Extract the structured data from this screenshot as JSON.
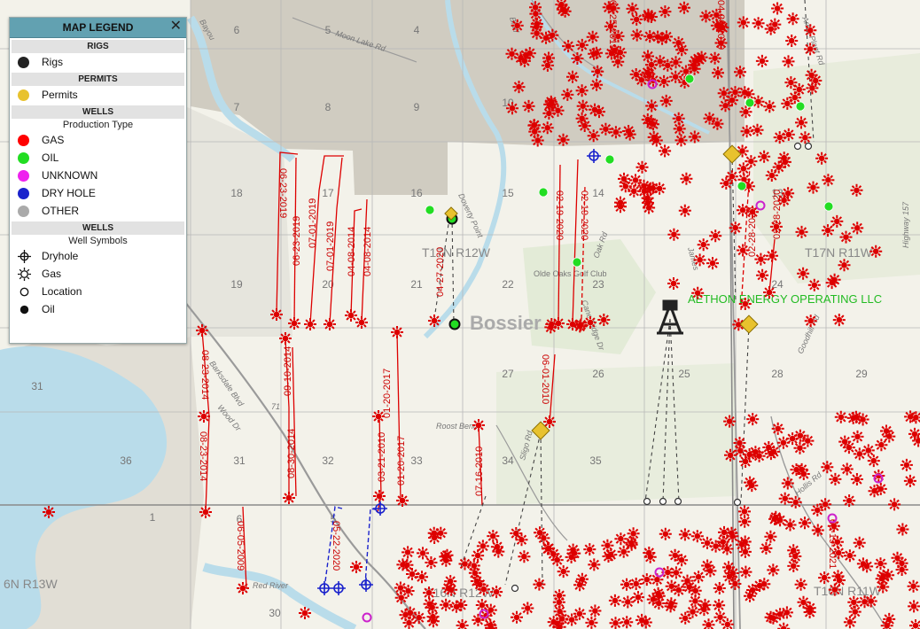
{
  "legend": {
    "title": "MAP LEGEND",
    "close_icon": "close-icon",
    "sections": {
      "rigs": {
        "header": "RIGS",
        "items": [
          {
            "label": "Rigs",
            "color": "#222222"
          }
        ]
      },
      "permits": {
        "header": "PERMITS",
        "items": [
          {
            "label": "Permits",
            "color": "#e8c22e"
          }
        ]
      },
      "wells": {
        "header": "WELLS",
        "subheader": "Production Type",
        "items": [
          {
            "label": "GAS",
            "color": "#ff0000"
          },
          {
            "label": "OIL",
            "color": "#22dd22"
          },
          {
            "label": "UNKNOWN",
            "color": "#ee22ee"
          },
          {
            "label": "DRY HOLE",
            "color": "#1a22cc"
          },
          {
            "label": "OTHER",
            "color": "#aaaaaa"
          }
        ]
      },
      "symbols": {
        "header": "WELLS",
        "subheader": "Well Symbols",
        "items": [
          {
            "label": "Dryhole",
            "icon": "dryhole-symbol-icon"
          },
          {
            "label": "Gas",
            "icon": "gas-symbol-icon"
          },
          {
            "label": "Location",
            "icon": "location-symbol-icon"
          },
          {
            "label": "Oil",
            "icon": "oil-symbol-icon"
          }
        ]
      }
    }
  },
  "map": {
    "colors": {
      "gas": "#dd0000",
      "oil": "#22dd22",
      "unknown": "#cc22cc",
      "dryhole": "#1a22cc",
      "permit": "#e8c22e",
      "water": "#b9dcea",
      "urban": "#c9c6ba"
    },
    "township_labels": [
      "T17N R12W",
      "T17N R11W",
      "T16N R12W",
      "T16N R11W",
      "6N R13W"
    ],
    "place_labels": [
      "Bossier",
      "Olde Oaks Golf Club"
    ],
    "operator_label": "AETHON ENERGY OPERATING LLC",
    "road_labels": [
      "Moon Lake Rd",
      "Arkla Plant Rd",
      "Bluff",
      "Doverty Point",
      "Oak Rd",
      "James",
      "Cane Ridge Dr",
      "Goodhill Rd",
      "Barksdale Blvd",
      "Wood Dr",
      "Red River",
      "Roost Bend",
      "Sligo Rd",
      "Highway 157",
      "Hollis Rd",
      "71",
      "Bayou"
    ],
    "section_numbers": [
      "6",
      "5",
      "4",
      "7",
      "8",
      "9",
      "10",
      "18",
      "17",
      "16",
      "15",
      "14",
      "13",
      "19",
      "20",
      "21",
      "22",
      "23",
      "24",
      "26",
      "27",
      "25",
      "28",
      "29",
      "36",
      "31",
      "32",
      "33",
      "34",
      "35",
      "1",
      "6",
      "30",
      "5"
    ],
    "date_labels": [
      "06-23-2019",
      "06-23-2019",
      "07-01-2019",
      "07-01-2019",
      "04-08-2014",
      "04-08-2014",
      "04-27-2020",
      "02-19-2020",
      "02-19-2020",
      "02-28-2020",
      "02-28-2020",
      "08-23-2014",
      "08-23-2014",
      "09-10-2014",
      "08-30-2014",
      "01-20-2017",
      "01-20-2017",
      "03-21-2010",
      "07-16-2010",
      "06-01-2010",
      "06-05-2009",
      "05-22-2020",
      "03-19-2021",
      "04-25-2019",
      "04-26-2019"
    ]
  }
}
